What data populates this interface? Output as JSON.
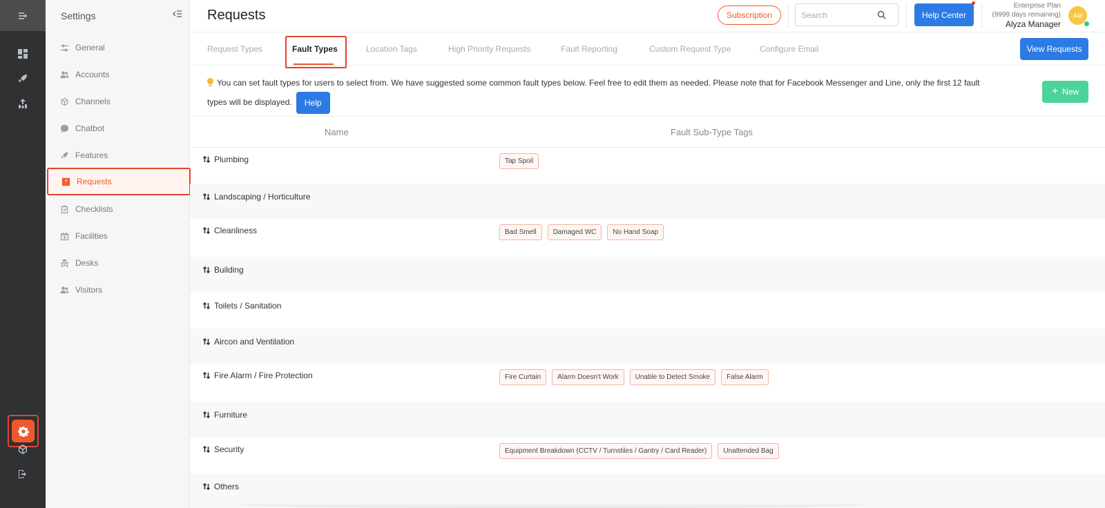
{
  "rail": {
    "items": [
      "menu-icon",
      "dashboard-icon",
      "rocket-icon",
      "analytics-icon",
      "settings-icon",
      "cube-icon",
      "logout-icon"
    ]
  },
  "sidebar": {
    "title": "Settings",
    "items": [
      {
        "label": "General",
        "icon": "sliders-icon"
      },
      {
        "label": "Accounts",
        "icon": "users-icon"
      },
      {
        "label": "Channels",
        "icon": "cube-icon"
      },
      {
        "label": "Chatbot",
        "icon": "chat-icon"
      },
      {
        "label": "Features",
        "icon": "rocket-icon"
      },
      {
        "label": "Requests",
        "icon": "question-icon",
        "active": true
      },
      {
        "label": "Checklists",
        "icon": "checklist-icon"
      },
      {
        "label": "Facilities",
        "icon": "calendar-icon"
      },
      {
        "label": "Desks",
        "icon": "desk-icon"
      },
      {
        "label": "Visitors",
        "icon": "users-icon"
      }
    ]
  },
  "header": {
    "title": "Requests",
    "subscription": "Subscription",
    "search_placeholder": "Search",
    "help_center": "Help Center",
    "plan": "Enterprise Plan",
    "days_remaining": "(9999 days remaining)",
    "user_name": "Alyza Manager",
    "avatar_initials": "AM"
  },
  "tabs": {
    "items": [
      "Request Types",
      "Fault Types",
      "Location Tags",
      "High Priority Requests",
      "Fault Reporting",
      "Custom Request Type",
      "Configure Email"
    ],
    "active": "Fault Types",
    "view_requests": "View Requests"
  },
  "banner": {
    "text": "You can set fault types for users to select from. We have suggested some common fault types below. Feel free to edit them as needed. Please note that for Facebook Messenger and Line, only the first 12 fault types will be displayed.",
    "help": "Help",
    "new": "New"
  },
  "table": {
    "col_name": "Name",
    "col_tags": "Fault Sub-Type Tags",
    "rows": [
      {
        "name": "Plumbing",
        "tags": [
          "Tap Spoil"
        ]
      },
      {
        "name": "Landscaping / Horticulture",
        "tags": []
      },
      {
        "name": "Cleanliness",
        "tags": [
          "Bad Smell",
          "Damaged WC",
          "No Hand Soap"
        ]
      },
      {
        "name": "Building",
        "tags": []
      },
      {
        "name": "Toilets / Sanitation",
        "tags": []
      },
      {
        "name": "Aircon and Ventilation",
        "tags": []
      },
      {
        "name": "Fire Alarm / Fire Protection",
        "tags": [
          "Fire Curtain",
          "Alarm Doesn't Work",
          "Unable to Detect Smoke",
          "False Alarm"
        ]
      },
      {
        "name": "Furniture",
        "tags": []
      },
      {
        "name": "Security",
        "tags": [
          "Equipment Breakdown (CCTV / Turnstiles / Gantry / Card Reader)",
          "Unattended Bag"
        ]
      },
      {
        "name": "Others",
        "tags": []
      }
    ]
  },
  "colors": {
    "accent": "#f05a28",
    "primary": "#2c7be5",
    "success": "#4cd39b",
    "rail_bg": "#2f3133"
  }
}
